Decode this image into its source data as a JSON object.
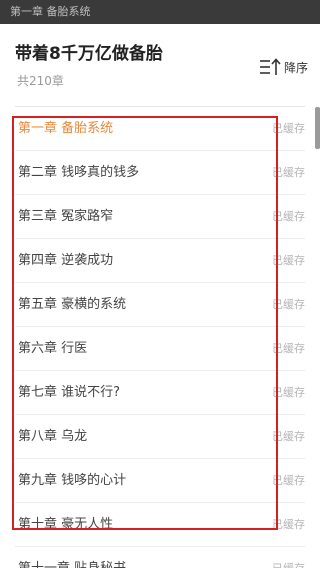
{
  "status_bar": {
    "text": "第一章 备胎系统"
  },
  "header": {
    "book_title": "带着8千万亿做备胎",
    "chapter_count": "共210章",
    "sort_label": "降序"
  },
  "chapters": [
    {
      "title": "第一章 备胎系统",
      "status": "已缓存",
      "current": true
    },
    {
      "title": "第二章 钱哆真的钱多",
      "status": "已缓存",
      "current": false
    },
    {
      "title": "第三章 冤家路窄",
      "status": "已缓存",
      "current": false
    },
    {
      "title": "第四章 逆袭成功",
      "status": "已缓存",
      "current": false
    },
    {
      "title": "第五章 豪横的系统",
      "status": "已缓存",
      "current": false
    },
    {
      "title": "第六章 行医",
      "status": "已缓存",
      "current": false
    },
    {
      "title": "第七章 谁说不行?",
      "status": "已缓存",
      "current": false
    },
    {
      "title": "第八章 乌龙",
      "status": "已缓存",
      "current": false
    },
    {
      "title": "第九章 钱哆的心计",
      "status": "已缓存",
      "current": false
    },
    {
      "title": "第十章 豪无人性",
      "status": "已缓存",
      "current": false
    },
    {
      "title": "第十一章 贴身秘书",
      "status": "已缓存",
      "current": false
    }
  ],
  "colors": {
    "accent_current": "#e8893c",
    "highlight_border": "#d42020"
  }
}
